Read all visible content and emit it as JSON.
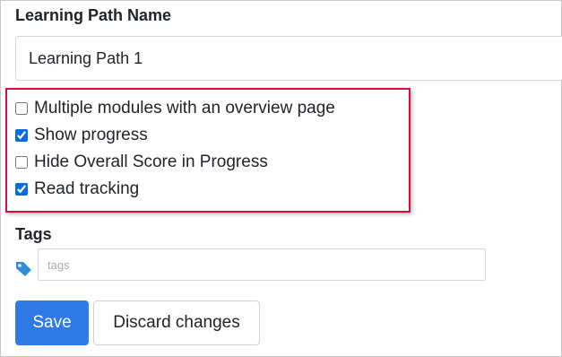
{
  "learning_path": {
    "label": "Learning Path Name",
    "value": "Learning Path 1"
  },
  "options": [
    {
      "label": "Multiple modules with an overview page",
      "checked": false
    },
    {
      "label": "Show progress",
      "checked": true
    },
    {
      "label": "Hide Overall Score in Progress",
      "checked": false
    },
    {
      "label": "Read tracking",
      "checked": true
    }
  ],
  "tags": {
    "label": "Tags",
    "placeholder": "tags",
    "icon": "tag-icon"
  },
  "actions": {
    "save_label": "Save",
    "discard_label": "Discard changes"
  },
  "colors": {
    "primary": "#2f7ae5",
    "highlight": "#d0103a",
    "tag_icon": "#2f8fd8"
  }
}
